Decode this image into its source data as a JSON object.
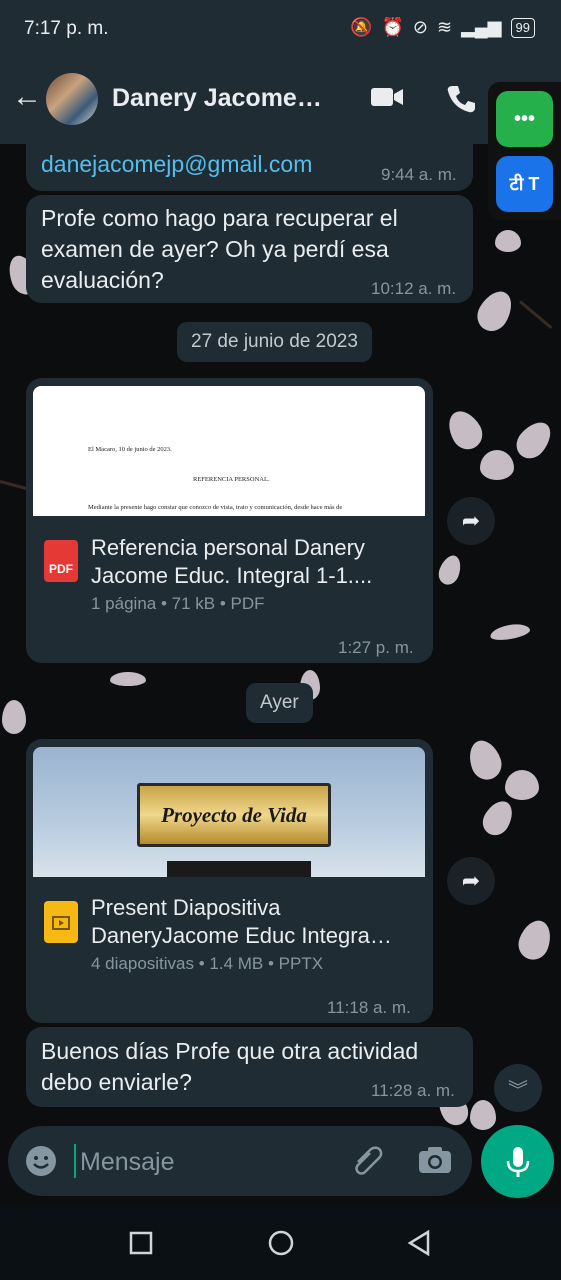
{
  "status_bar": {
    "time": "7:17 p. m.",
    "battery": "99"
  },
  "header": {
    "contact_name": "Danery Jacome…"
  },
  "messages": [
    {
      "text": "danejacomejp@gmail.com",
      "time": "9:44 a. m."
    },
    {
      "text": "Profe como hago para recuperar el examen de ayer? Oh ya perdí esa evaluación?",
      "time": "10:12 a. m."
    }
  ],
  "date_separators": [
    "27 de junio de 2023",
    "Ayer"
  ],
  "documents": [
    {
      "preview_lines": [
        "El Macaro, 10 de junio de 2023.",
        "REFERENCIA PERSONAL.",
        "Mediante la presente hago constar que conozco de vista, trato y comunicación, desde hace más de"
      ],
      "title": "Referencia personal Danery Jacome  Educ. Integral 1-1....",
      "meta": "1 página • 71 kB • PDF",
      "icon_label": "PDF",
      "time": "1:27 p. m."
    },
    {
      "preview_title": "Proyecto de Vida",
      "title": "Present Diapositiva DaneryJacome Educ Integra…",
      "meta": "4 diapositivas • 1.4 MB • PPTX",
      "time": "11:18 a. m."
    }
  ],
  "last_message": {
    "text": "Buenos días Profe que otra actividad debo enviarle?",
    "time": "11:28 a. m."
  },
  "input": {
    "placeholder": "Mensaje"
  },
  "float_buttons": [
    {
      "label": "•••"
    },
    {
      "label": "टी T"
    }
  ]
}
